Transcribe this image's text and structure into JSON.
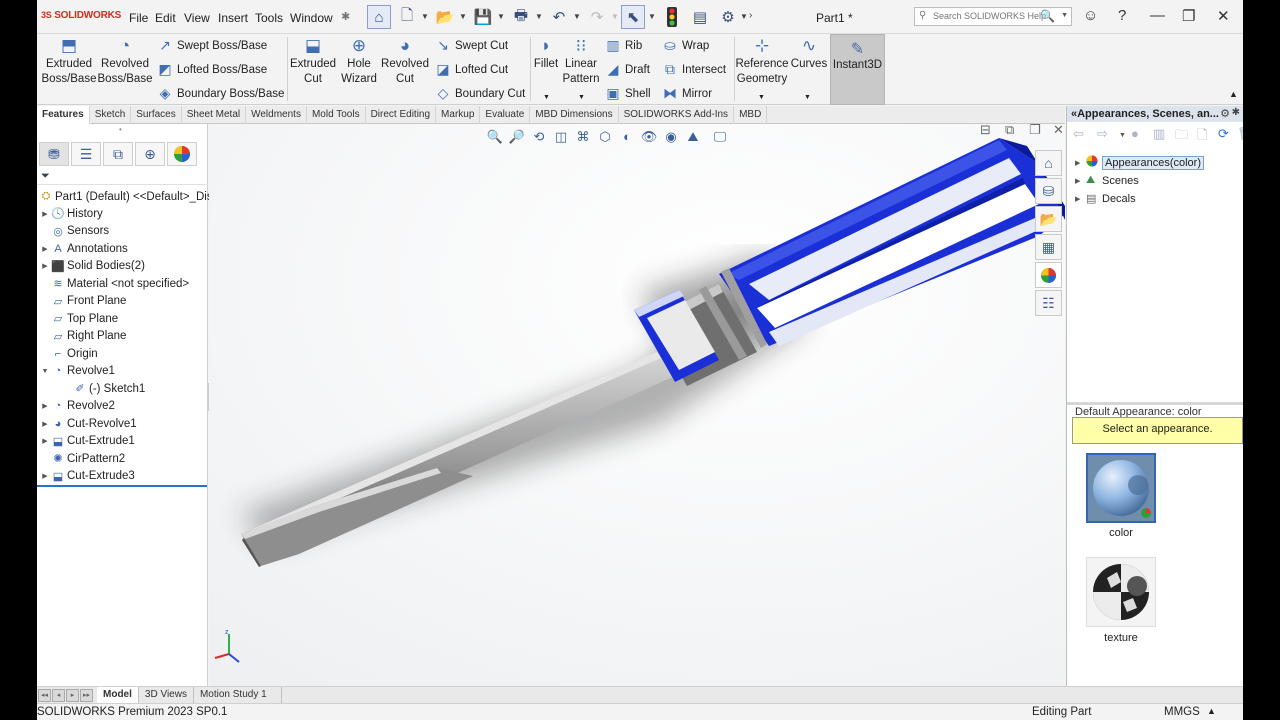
{
  "app": {
    "logo_ds": "3S",
    "logo_text": "SOLIDWORKS",
    "document_title": "Part1 *"
  },
  "menu": [
    "File",
    "Edit",
    "View",
    "Insert",
    "Tools",
    "Window"
  ],
  "search": {
    "placeholder": "Search SOLIDWORKS Help"
  },
  "commands": {
    "extruded_boss": "Extruded Boss/Base",
    "revolved_boss": "Revolved Boss/Base",
    "swept_boss": "Swept Boss/Base",
    "lofted_boss": "Lofted Boss/Base",
    "boundary_boss": "Boundary Boss/Base",
    "extruded_cut": "Extruded Cut",
    "hole_wizard": "Hole Wizard",
    "revolved_cut": "Revolved Cut",
    "swept_cut": "Swept Cut",
    "lofted_cut": "Lofted Cut",
    "boundary_cut": "Boundary Cut",
    "fillet": "Fillet",
    "linear_pattern": "Linear Pattern",
    "rib": "Rib",
    "draft": "Draft",
    "shell": "Shell",
    "wrap": "Wrap",
    "intersect": "Intersect",
    "mirror": "Mirror",
    "reference_geometry": "Reference Geometry",
    "curves": "Curves",
    "instant3d": "Instant3D"
  },
  "tabs": [
    "Features",
    "Sketch",
    "Surfaces",
    "Sheet Metal",
    "Weldments",
    "Mold Tools",
    "Direct Editing",
    "Markup",
    "Evaluate",
    "MBD Dimensions",
    "SOLIDWORKS Add-Ins",
    "MBD"
  ],
  "tree": {
    "root": "Part1 (Default) <<Default>_Dis",
    "items": [
      {
        "label": "History",
        "arrow": true,
        "icon": "history-icon",
        "indent": 0
      },
      {
        "label": "Sensors",
        "arrow": false,
        "icon": "sensor-icon",
        "indent": 0
      },
      {
        "label": "Annotations",
        "arrow": true,
        "icon": "annotation-icon",
        "indent": 0
      },
      {
        "label": "Solid Bodies(2)",
        "arrow": true,
        "icon": "solid-bodies-icon",
        "indent": 0
      },
      {
        "label": "Material <not specified>",
        "arrow": false,
        "icon": "material-icon",
        "indent": 0
      },
      {
        "label": "Front Plane",
        "arrow": false,
        "icon": "plane-icon",
        "indent": 0
      },
      {
        "label": "Top Plane",
        "arrow": false,
        "icon": "plane-icon",
        "indent": 0
      },
      {
        "label": "Right Plane",
        "arrow": false,
        "icon": "plane-icon",
        "indent": 0
      },
      {
        "label": "Origin",
        "arrow": false,
        "icon": "origin-icon",
        "indent": 0
      },
      {
        "label": "Revolve1",
        "arrow": "open",
        "icon": "revolve-icon",
        "indent": 0
      },
      {
        "label": "(-) Sketch1",
        "arrow": false,
        "icon": "sketch-icon",
        "indent": 1
      },
      {
        "label": "Revolve2",
        "arrow": true,
        "icon": "revolve-icon",
        "indent": 0
      },
      {
        "label": "Cut-Revolve1",
        "arrow": true,
        "icon": "cut-revolve-icon",
        "indent": 0
      },
      {
        "label": "Cut-Extrude1",
        "arrow": true,
        "icon": "cut-extrude-icon",
        "indent": 0
      },
      {
        "label": "CirPattern2",
        "arrow": false,
        "icon": "circular-pattern-icon",
        "indent": 0
      },
      {
        "label": "Cut-Extrude3",
        "arrow": true,
        "icon": "cut-extrude-icon",
        "indent": 0
      }
    ]
  },
  "appearances": {
    "header": "«Appearances, Scenes, an...",
    "items": [
      "Appearances(color)",
      "Scenes",
      "Decals"
    ],
    "default_label": "Default Appearance: color",
    "tooltip": "Select an appearance.",
    "swatches": [
      "color",
      "texture"
    ]
  },
  "bottom_tabs": [
    "Model",
    "3D Views",
    "Motion Study 1"
  ],
  "status": {
    "version": "SOLIDWORKS Premium 2023 SP0.1",
    "mode": "Editing Part",
    "units": "MMGS"
  },
  "colors": {
    "handle_blue": "#1a2fd6",
    "accent": "#d52b1e"
  }
}
